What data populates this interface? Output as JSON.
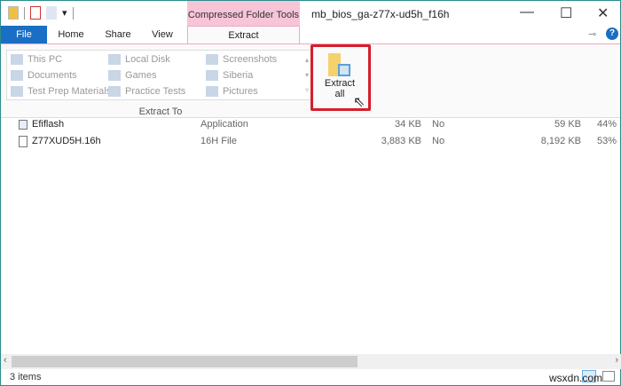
{
  "window": {
    "title": "mb_bios_ga-z77x-ud5h_f16h",
    "context_tab_group": "Compressed Folder Tools"
  },
  "tabs": [
    "File",
    "Home",
    "Share",
    "View",
    "Extract"
  ],
  "ribbon": {
    "destinations": [
      "This PC",
      "Local Disk",
      "Screenshots",
      "Documents",
      "Games",
      "Siberia",
      "Test Prep Materials",
      "Practice Tests",
      "Pictures"
    ],
    "group_label": "Extract To",
    "extract_all_line1": "Extract",
    "extract_all_line2": "all"
  },
  "files": [
    {
      "name": "Efiflash",
      "type": "Application",
      "compressed": "34 KB",
      "password": "No",
      "size": "59 KB",
      "ratio": "44%"
    },
    {
      "name": "Z77XUD5H.16h",
      "type": "16H File",
      "compressed": "3,883 KB",
      "password": "No",
      "size": "8,192 KB",
      "ratio": "53%"
    }
  ],
  "status": {
    "items": "3 items"
  },
  "watermark": "wsxdn.com"
}
